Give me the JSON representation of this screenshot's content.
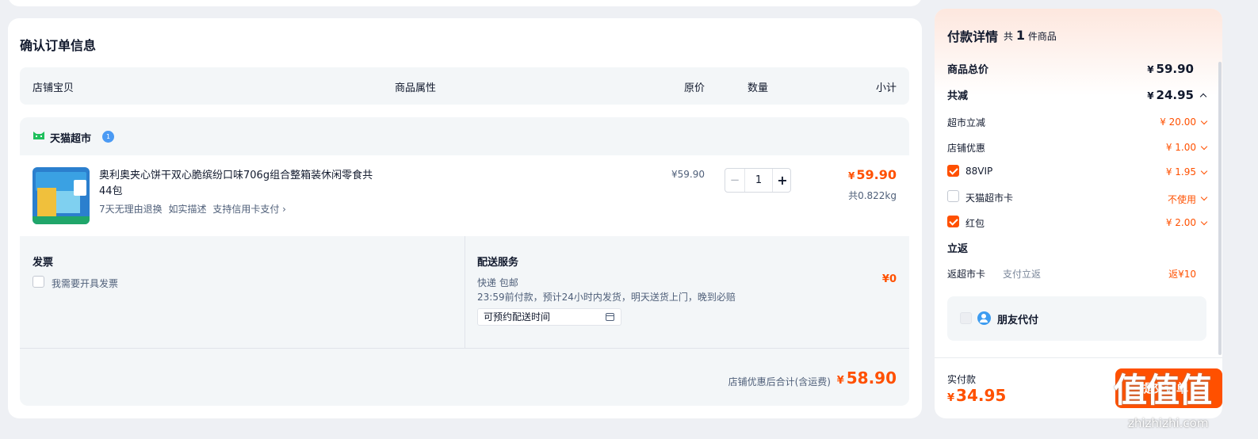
{
  "order": {
    "title": "确认订单信息",
    "columns": [
      "店铺宝贝",
      "商品属性",
      "原价",
      "数量",
      "小计"
    ]
  },
  "store": {
    "name": "天猫超市",
    "badge": "1",
    "item": {
      "title": "奥利奥夹心饼干双心脆缤纷口味706g组合整箱装休闲零食共44包",
      "tags": [
        "7天无理由退换",
        "如实描述",
        "支持信用卡支付 ›"
      ],
      "original_price": "¥59.90",
      "quantity": "1",
      "minus": "−",
      "plus": "+",
      "subtotal_currency": "¥",
      "subtotal": "59.90",
      "weight": "共0.822kg"
    },
    "invoice": {
      "title": "发票",
      "checkbox_label": "我需要开具发票"
    },
    "delivery": {
      "title": "配送服务",
      "method": "快递 包邮",
      "eta": "23:59前付款，预计24小时内发货，明天送货上门，晚到必赔",
      "schedule_placeholder": "可预约配送时间",
      "fee": "¥0"
    },
    "footer": {
      "label": "店铺优惠后合计(含运费)",
      "currency": "¥",
      "total": "58.90"
    }
  },
  "payment": {
    "title": "付款详情",
    "count_prefix": "共",
    "count": "1",
    "count_suffix": "件商品",
    "goods_total_label": "商品总价",
    "goods_total": "59.90",
    "discount_label": "共减",
    "discount_total": "24.95",
    "currency": "¥",
    "lines": [
      {
        "label": "超市立减",
        "value": "¥ 20.00"
      },
      {
        "label": "店铺优惠",
        "value": "¥ 1.00"
      },
      {
        "label": "88VIP",
        "value": "¥ 1.95",
        "checked": true
      },
      {
        "label": "天猫超市卡",
        "value": "不使用",
        "checked": false
      },
      {
        "label": "红包",
        "value": "¥ 2.00",
        "checked": true
      }
    ],
    "rebate_title": "立返",
    "rebate_label": "返超市卡",
    "rebate_sub": "支付立返",
    "rebate_value": "返¥10",
    "friend_pay": "朋友代付",
    "final_label": "实付款",
    "final_value": "34.95",
    "submit": "提交订单"
  },
  "watermark": {
    "glyphs": "值值值",
    "url": "zhizhizhi.com"
  },
  "colors": {
    "accent": "#ff5000",
    "panel_bg": "#f3f6f8",
    "page_bg": "#eef0f4"
  }
}
